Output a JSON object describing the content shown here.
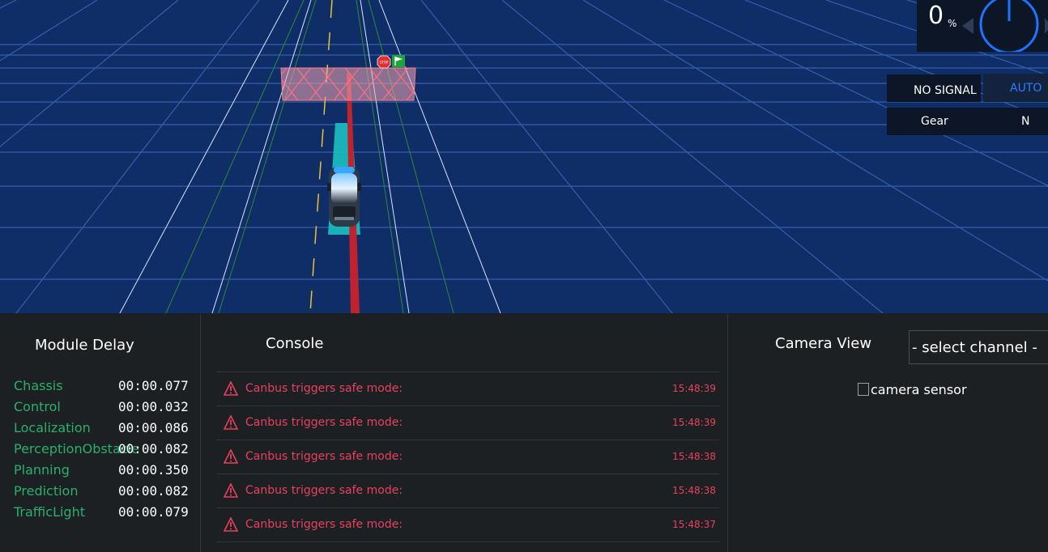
{
  "hud": {
    "throttle_value": "0",
    "throttle_unit": "%",
    "signal_label": "NO SIGNAL",
    "drive_mode": "AUTO",
    "gear_label": "Gear",
    "gear_value": "N"
  },
  "scene": {
    "stop_sign_text": "STOP"
  },
  "module_delay": {
    "title": "Module Delay",
    "rows": [
      {
        "name": "Chassis",
        "value": "00:00.077"
      },
      {
        "name": "Control",
        "value": "00:00.032"
      },
      {
        "name": "Localization",
        "value": "00:00.086"
      },
      {
        "name": "PerceptionObstacle",
        "value": "00:00.082"
      },
      {
        "name": "Planning",
        "value": "00:00.350"
      },
      {
        "name": "Prediction",
        "value": "00:00.082"
      },
      {
        "name": "TrafficLight",
        "value": "00:00.079"
      }
    ]
  },
  "console": {
    "title": "Console",
    "messages": [
      {
        "text": "Canbus triggers safe mode:",
        "time": "15:48:39"
      },
      {
        "text": "Canbus triggers safe mode:",
        "time": "15:48:39"
      },
      {
        "text": "Canbus triggers safe mode:",
        "time": "15:48:38"
      },
      {
        "text": "Canbus triggers safe mode:",
        "time": "15:48:38"
      },
      {
        "text": "Canbus triggers safe mode:",
        "time": "15:48:37"
      }
    ]
  },
  "camera": {
    "title": "Camera View",
    "channel_placeholder": "- select channel -",
    "image_alt": "camera sensor"
  },
  "colors": {
    "scene_bg": "#0f2d66",
    "panel_bg": "#1d2023",
    "module_name": "#2aaf6c",
    "console_error": "#e8405e",
    "auto_mode": "#2f7bff"
  }
}
